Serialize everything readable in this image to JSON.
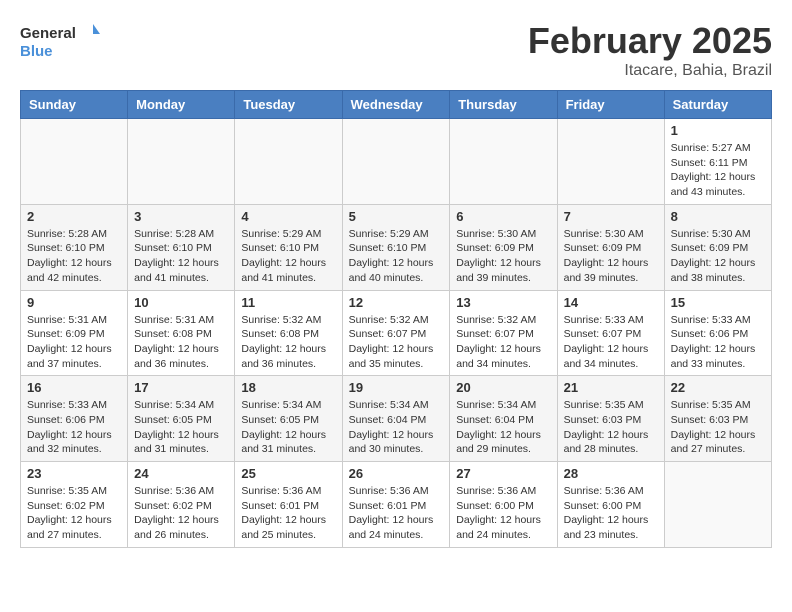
{
  "header": {
    "logo": {
      "general": "General",
      "blue": "Blue"
    },
    "month": "February 2025",
    "location": "Itacare, Bahia, Brazil"
  },
  "weekdays": [
    "Sunday",
    "Monday",
    "Tuesday",
    "Wednesday",
    "Thursday",
    "Friday",
    "Saturday"
  ],
  "weeks": [
    [
      {
        "day": "",
        "sunrise": "",
        "sunset": "",
        "daylight": ""
      },
      {
        "day": "",
        "sunrise": "",
        "sunset": "",
        "daylight": ""
      },
      {
        "day": "",
        "sunrise": "",
        "sunset": "",
        "daylight": ""
      },
      {
        "day": "",
        "sunrise": "",
        "sunset": "",
        "daylight": ""
      },
      {
        "day": "",
        "sunrise": "",
        "sunset": "",
        "daylight": ""
      },
      {
        "day": "",
        "sunrise": "",
        "sunset": "",
        "daylight": ""
      },
      {
        "day": "1",
        "sunrise": "Sunrise: 5:27 AM",
        "sunset": "Sunset: 6:11 PM",
        "daylight": "Daylight: 12 hours and 43 minutes."
      }
    ],
    [
      {
        "day": "2",
        "sunrise": "Sunrise: 5:28 AM",
        "sunset": "Sunset: 6:10 PM",
        "daylight": "Daylight: 12 hours and 42 minutes."
      },
      {
        "day": "3",
        "sunrise": "Sunrise: 5:28 AM",
        "sunset": "Sunset: 6:10 PM",
        "daylight": "Daylight: 12 hours and 41 minutes."
      },
      {
        "day": "4",
        "sunrise": "Sunrise: 5:29 AM",
        "sunset": "Sunset: 6:10 PM",
        "daylight": "Daylight: 12 hours and 41 minutes."
      },
      {
        "day": "5",
        "sunrise": "Sunrise: 5:29 AM",
        "sunset": "Sunset: 6:10 PM",
        "daylight": "Daylight: 12 hours and 40 minutes."
      },
      {
        "day": "6",
        "sunrise": "Sunrise: 5:30 AM",
        "sunset": "Sunset: 6:09 PM",
        "daylight": "Daylight: 12 hours and 39 minutes."
      },
      {
        "day": "7",
        "sunrise": "Sunrise: 5:30 AM",
        "sunset": "Sunset: 6:09 PM",
        "daylight": "Daylight: 12 hours and 39 minutes."
      },
      {
        "day": "8",
        "sunrise": "Sunrise: 5:30 AM",
        "sunset": "Sunset: 6:09 PM",
        "daylight": "Daylight: 12 hours and 38 minutes."
      }
    ],
    [
      {
        "day": "9",
        "sunrise": "Sunrise: 5:31 AM",
        "sunset": "Sunset: 6:09 PM",
        "daylight": "Daylight: 12 hours and 37 minutes."
      },
      {
        "day": "10",
        "sunrise": "Sunrise: 5:31 AM",
        "sunset": "Sunset: 6:08 PM",
        "daylight": "Daylight: 12 hours and 36 minutes."
      },
      {
        "day": "11",
        "sunrise": "Sunrise: 5:32 AM",
        "sunset": "Sunset: 6:08 PM",
        "daylight": "Daylight: 12 hours and 36 minutes."
      },
      {
        "day": "12",
        "sunrise": "Sunrise: 5:32 AM",
        "sunset": "Sunset: 6:07 PM",
        "daylight": "Daylight: 12 hours and 35 minutes."
      },
      {
        "day": "13",
        "sunrise": "Sunrise: 5:32 AM",
        "sunset": "Sunset: 6:07 PM",
        "daylight": "Daylight: 12 hours and 34 minutes."
      },
      {
        "day": "14",
        "sunrise": "Sunrise: 5:33 AM",
        "sunset": "Sunset: 6:07 PM",
        "daylight": "Daylight: 12 hours and 34 minutes."
      },
      {
        "day": "15",
        "sunrise": "Sunrise: 5:33 AM",
        "sunset": "Sunset: 6:06 PM",
        "daylight": "Daylight: 12 hours and 33 minutes."
      }
    ],
    [
      {
        "day": "16",
        "sunrise": "Sunrise: 5:33 AM",
        "sunset": "Sunset: 6:06 PM",
        "daylight": "Daylight: 12 hours and 32 minutes."
      },
      {
        "day": "17",
        "sunrise": "Sunrise: 5:34 AM",
        "sunset": "Sunset: 6:05 PM",
        "daylight": "Daylight: 12 hours and 31 minutes."
      },
      {
        "day": "18",
        "sunrise": "Sunrise: 5:34 AM",
        "sunset": "Sunset: 6:05 PM",
        "daylight": "Daylight: 12 hours and 31 minutes."
      },
      {
        "day": "19",
        "sunrise": "Sunrise: 5:34 AM",
        "sunset": "Sunset: 6:04 PM",
        "daylight": "Daylight: 12 hours and 30 minutes."
      },
      {
        "day": "20",
        "sunrise": "Sunrise: 5:34 AM",
        "sunset": "Sunset: 6:04 PM",
        "daylight": "Daylight: 12 hours and 29 minutes."
      },
      {
        "day": "21",
        "sunrise": "Sunrise: 5:35 AM",
        "sunset": "Sunset: 6:03 PM",
        "daylight": "Daylight: 12 hours and 28 minutes."
      },
      {
        "day": "22",
        "sunrise": "Sunrise: 5:35 AM",
        "sunset": "Sunset: 6:03 PM",
        "daylight": "Daylight: 12 hours and 27 minutes."
      }
    ],
    [
      {
        "day": "23",
        "sunrise": "Sunrise: 5:35 AM",
        "sunset": "Sunset: 6:02 PM",
        "daylight": "Daylight: 12 hours and 27 minutes."
      },
      {
        "day": "24",
        "sunrise": "Sunrise: 5:36 AM",
        "sunset": "Sunset: 6:02 PM",
        "daylight": "Daylight: 12 hours and 26 minutes."
      },
      {
        "day": "25",
        "sunrise": "Sunrise: 5:36 AM",
        "sunset": "Sunset: 6:01 PM",
        "daylight": "Daylight: 12 hours and 25 minutes."
      },
      {
        "day": "26",
        "sunrise": "Sunrise: 5:36 AM",
        "sunset": "Sunset: 6:01 PM",
        "daylight": "Daylight: 12 hours and 24 minutes."
      },
      {
        "day": "27",
        "sunrise": "Sunrise: 5:36 AM",
        "sunset": "Sunset: 6:00 PM",
        "daylight": "Daylight: 12 hours and 24 minutes."
      },
      {
        "day": "28",
        "sunrise": "Sunrise: 5:36 AM",
        "sunset": "Sunset: 6:00 PM",
        "daylight": "Daylight: 12 hours and 23 minutes."
      },
      {
        "day": "",
        "sunrise": "",
        "sunset": "",
        "daylight": ""
      }
    ]
  ]
}
